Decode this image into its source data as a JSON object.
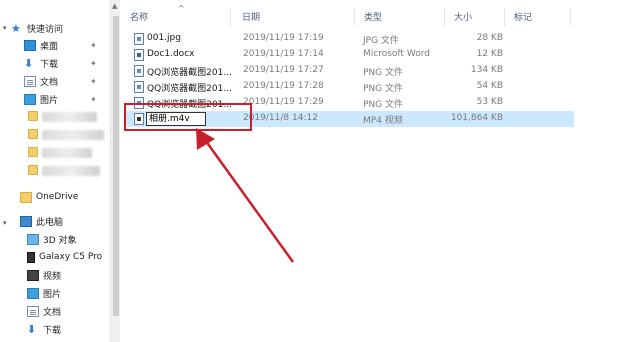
{
  "sidebar": {
    "quick_access": "快速访问",
    "items": [
      {
        "label": "桌面",
        "icon": "desktop-icon"
      },
      {
        "label": "下载",
        "icon": "download-icon"
      },
      {
        "label": "文档",
        "icon": "document-icon"
      },
      {
        "label": "图片",
        "icon": "pictures-icon"
      }
    ],
    "onedrive": "OneDrive",
    "this_pc": "此电脑",
    "pc_items": [
      {
        "label": "3D 对象",
        "icon": "3d-objects-icon"
      },
      {
        "label": "Galaxy C5 Pro",
        "icon": "phone-icon"
      },
      {
        "label": "视频",
        "icon": "videos-icon"
      },
      {
        "label": "图片",
        "icon": "pictures-icon"
      },
      {
        "label": "文档",
        "icon": "document-icon"
      },
      {
        "label": "下载",
        "icon": "download-icon"
      }
    ]
  },
  "columns": {
    "name": "名称",
    "date": "日期",
    "type": "类型",
    "size": "大小",
    "tags": "标记"
  },
  "files": [
    {
      "name": "001.jpg",
      "date": "2019/11/19 17:19",
      "type": "JPG 文件",
      "size": "28 KB"
    },
    {
      "name": "Doc1.docx",
      "date": "2019/11/19 17:14",
      "type": "Microsoft Word",
      "size": "12 KB"
    },
    {
      "name": "QQ浏览器截图201...",
      "date": "2019/11/19 17:27",
      "type": "PNG 文件",
      "size": "134 KB"
    },
    {
      "name": "QQ浏览器截图201...",
      "date": "2019/11/19 17:28",
      "type": "PNG 文件",
      "size": "54 KB"
    },
    {
      "name": "QQ浏览器截图201...",
      "date": "2019/11/19 17:29",
      "type": "PNG 文件",
      "size": "53 KB"
    },
    {
      "name": "相册.m4v",
      "date": "2019/11/8 14:12",
      "type": "MP4 视频",
      "size": "101,864 KB"
    }
  ],
  "colors": {
    "selection": "#cce8ff",
    "annotation": "#c8202a",
    "accent": "#2d7fd6"
  }
}
